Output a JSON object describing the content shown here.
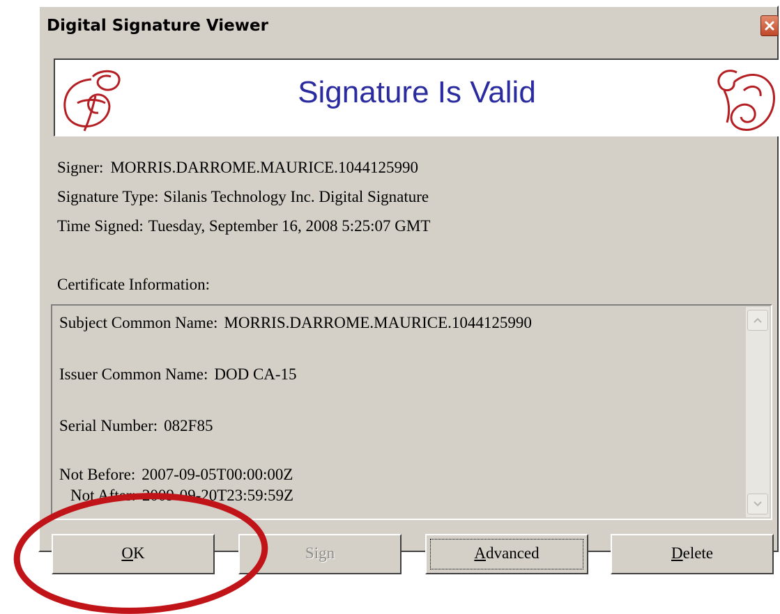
{
  "window": {
    "title": "Digital Signature Viewer",
    "close_icon": "close-icon"
  },
  "banner": {
    "title": "Signature Is Valid",
    "title_color": "#2b2ba0",
    "seal_color": "#b41e22"
  },
  "info": {
    "signer_label": "Signer:",
    "signer_value": "MORRIS.DARROME.MAURICE.1044125990",
    "type_label": "Signature Type:",
    "type_value": "Silanis Technology Inc. Digital Signature",
    "time_label": "Time Signed:",
    "time_value": "Tuesday, September 16, 2008 5:25:07 GMT",
    "cert_heading": "Certificate Information:"
  },
  "certificate": {
    "subject_label": "Subject Common Name:",
    "subject_value": "MORRIS.DARROME.MAURICE.1044125990",
    "issuer_label": "Issuer Common Name:",
    "issuer_value": "DOD CA-15",
    "serial_label": "Serial Number:",
    "serial_value": "082F85",
    "not_before_label": "Not Before:",
    "not_before_value": "2007-09-05T00:00:00Z",
    "not_after_label": "Not After:",
    "not_after_value": "2009-09-20T23:59:59Z"
  },
  "buttons": {
    "ok": {
      "mnemonic": "O",
      "rest": "K"
    },
    "sign": {
      "label": "Sign",
      "disabled": true
    },
    "advanced": {
      "mnemonic": "A",
      "rest": "dvanced"
    },
    "delete": {
      "mnemonic": "D",
      "rest": "elete"
    }
  },
  "annotation": {
    "color": "#c01418",
    "shape": "ellipse around OK button"
  }
}
